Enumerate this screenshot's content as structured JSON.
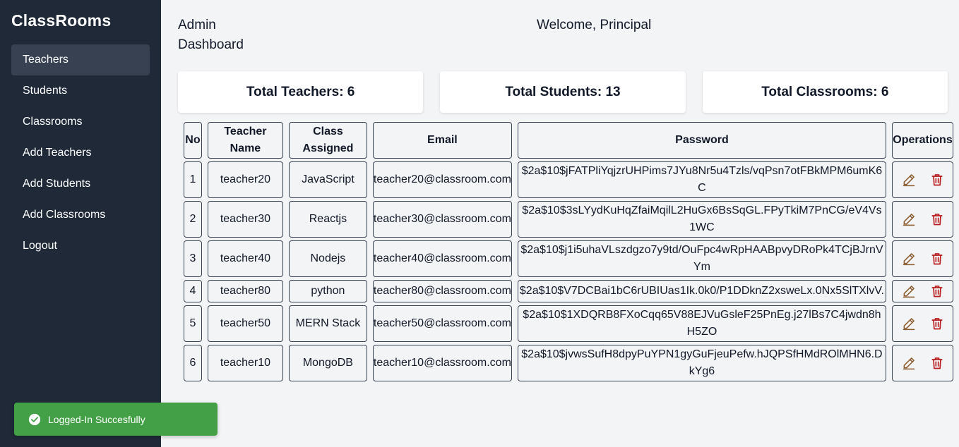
{
  "sidebar": {
    "brand": "ClassRooms",
    "items": [
      {
        "label": "Teachers",
        "active": true
      },
      {
        "label": "Students"
      },
      {
        "label": "Classrooms"
      },
      {
        "label": "Add Teachers"
      },
      {
        "label": "Add Students"
      },
      {
        "label": "Add Classrooms"
      },
      {
        "label": "Logout"
      }
    ]
  },
  "header": {
    "title": "Admin Dashboard",
    "welcome": "Welcome, Principal"
  },
  "stats": {
    "teachers": "Total Teachers: 6",
    "students": "Total Students: 13",
    "classrooms": "Total Classrooms: 6"
  },
  "table": {
    "headers": {
      "no": "No",
      "name": "Teacher Name",
      "class": "Class Assigned",
      "email": "Email",
      "password": "Password",
      "operations": "Operations"
    },
    "rows": [
      {
        "no": "1",
        "name": "teacher20",
        "class": "JavaScript",
        "email": "teacher20@classroom.com",
        "password": "$2a$10$jFATPliYqjzrUHPims7JYu8Nr5u4Tzls/vqPsn7otFBkMPM6umK6C"
      },
      {
        "no": "2",
        "name": "teacher30",
        "class": "Reactjs",
        "email": "teacher30@classroom.com",
        "password": "$2a$10$3sLYydKuHqZfaiMqilL2HuGx6BsSqGL.FPyTkiM7PnCG/eV4Vs1WC"
      },
      {
        "no": "3",
        "name": "teacher40",
        "class": "Nodejs",
        "email": "teacher40@classroom.com",
        "password": "$2a$10$j1i5uhaVLszdgzo7y9td/OuFpc4wRpHAABpvyDRoPk4TCjBJrnVYm"
      },
      {
        "no": "4",
        "name": "teacher80",
        "class": "python",
        "email": "teacher80@classroom.com",
        "password": "$2a$10$V7DCBai1bC6rUBIUas1Ik.0k0/P1DDknZ2xsweLx.0Nx5SlTXlvV."
      },
      {
        "no": "5",
        "name": "teacher50",
        "class": "MERN Stack",
        "email": "teacher50@classroom.com",
        "password": "$2a$10$1XDQRB8FXoCqq65V88EJVuGsleF25PnEg.j27lBs7C4jwdn8hH5ZO"
      },
      {
        "no": "6",
        "name": "teacher10",
        "class": "MongoDB",
        "email": "teacher10@classroom.com",
        "password": "$2a$10$jvwsSufH8dpyPuYPN1gyGuFjeuPefw.hJQPSfHMdROlMHN6.DkYg6"
      }
    ]
  },
  "toast": {
    "message": "Logged-In Succesfully",
    "icon": "check-circle-icon",
    "color": "#43a047"
  },
  "colors": {
    "sidebar": "#1f2937",
    "edit_icon": "#8a5a2b",
    "delete_icon": "#b91c1c"
  }
}
